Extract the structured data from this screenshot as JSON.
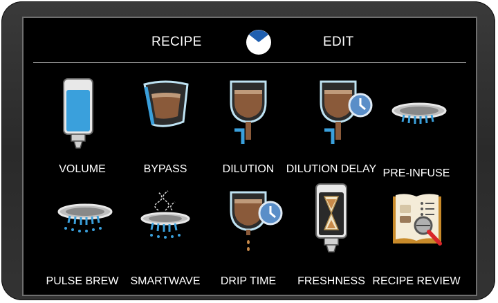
{
  "header": {
    "left_label": "RECIPE",
    "right_label": "EDIT",
    "logo_icon": "clock-logo-icon"
  },
  "tiles": [
    {
      "label": "VOLUME",
      "icon": "volume-icon"
    },
    {
      "label": "BYPASS",
      "icon": "bypass-icon"
    },
    {
      "label": "DILUTION",
      "icon": "dilution-icon"
    },
    {
      "label": "DILUTION DELAY",
      "icon": "dilution-delay-icon"
    },
    {
      "label": "PRE-INFUSE",
      "icon": "pre-infuse-icon"
    },
    {
      "label": "PULSE BREW",
      "icon": "pulse-brew-icon"
    },
    {
      "label": "SMARTWAVE",
      "icon": "smartwave-icon"
    },
    {
      "label": "DRIP TIME",
      "icon": "drip-time-icon"
    },
    {
      "label": "FRESHNESS",
      "icon": "freshness-icon"
    },
    {
      "label": "RECIPE REVIEW",
      "icon": "recipe-review-icon"
    }
  ],
  "colors": {
    "background": "#000000",
    "text": "#ffffff",
    "water_blue": "#3aa0dc",
    "coffee_brown": "#8a5a3a",
    "clock_blue": "#5a8ec8",
    "book_gold": "#c88a2a",
    "magnifier_red": "#d8262a"
  }
}
